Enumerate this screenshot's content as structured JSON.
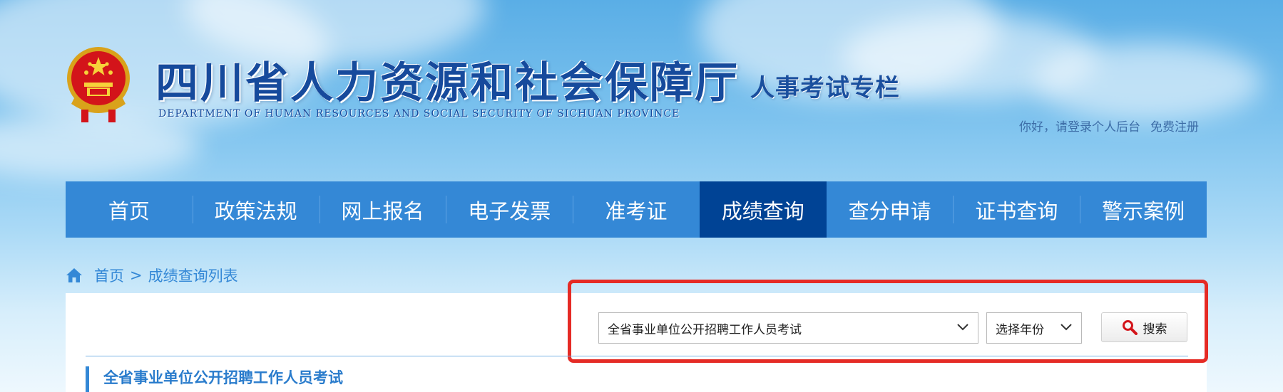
{
  "header": {
    "site_title": "四川省人力资源和社会保障厅",
    "site_subtitle": "DEPARTMENT OF HUMAN RESOURCES AND SOCIAL SECURITY OF SICHUAN PROVINCE",
    "column_title": "人事考试专栏",
    "emblem_icon": "national-emblem-icon"
  },
  "user_links": {
    "login": "你好，请登录个人后台",
    "register": "免费注册"
  },
  "nav": {
    "items": [
      "首页",
      "政策法规",
      "网上报名",
      "电子发票",
      "准考证",
      "成绩查询",
      "查分申请",
      "证书查询",
      "警示案例"
    ],
    "active": "成绩查询"
  },
  "breadcrumb": {
    "home_icon": "home-icon",
    "home": "首页",
    "separator": ">",
    "current": "成绩查询列表"
  },
  "search": {
    "exam_selected": "全省事业单位公开招聘工作人员考试",
    "year_selected": "选择年份",
    "button_label": "搜索",
    "button_icon": "search-icon",
    "highlight_color": "#e52b25"
  },
  "section": {
    "title": "全省事业单位公开招聘工作人员考试"
  },
  "colors": {
    "nav_bg": "#3488d6",
    "nav_active_bg": "#004395",
    "title_blue": "#164a9c"
  }
}
